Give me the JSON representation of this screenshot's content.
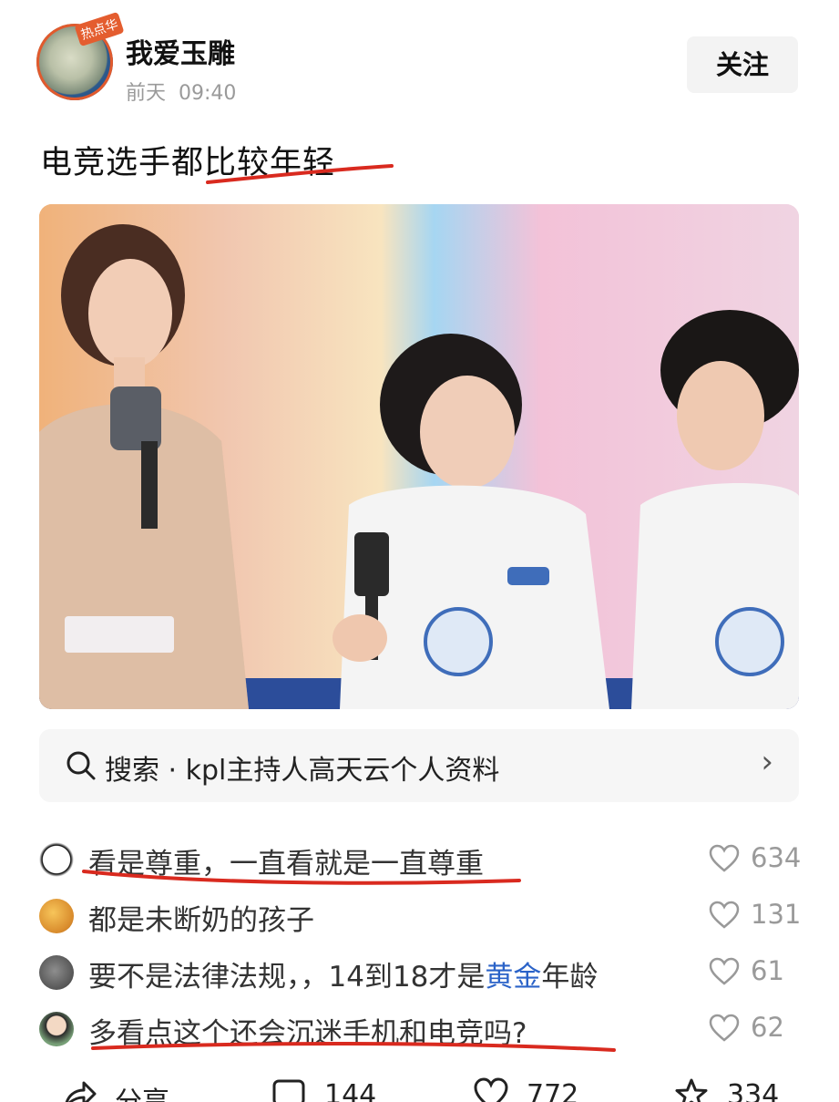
{
  "post": {
    "author": "我爱玉雕",
    "avatar_badge": "热点华",
    "time_day": "前天",
    "time_clock": "09:40",
    "follow_label": "关注",
    "text": "电竞选手都比较年轻"
  },
  "search": {
    "icon": "search-icon",
    "text": "搜索 · kpl主持人高天云个人资料",
    "arrow": "›"
  },
  "comments": [
    {
      "text": "看是尊重，一直看就是一直尊重",
      "likes": "634"
    },
    {
      "text": "都是未断奶的孩子",
      "likes": "131"
    },
    {
      "text_before": "要不是法律法规，，14到18才是",
      "highlight": "黄金",
      "text_after": "年龄",
      "likes": "61"
    },
    {
      "text": "多看点这个还会沉迷手机和电竞吗?",
      "likes": "62"
    }
  ],
  "footer": {
    "share_label": "分享",
    "comment_count": "144",
    "like_count": "772",
    "star_count": "334"
  },
  "colors": {
    "annotation_red": "#d92a1f",
    "link_blue": "#2b63c8"
  }
}
